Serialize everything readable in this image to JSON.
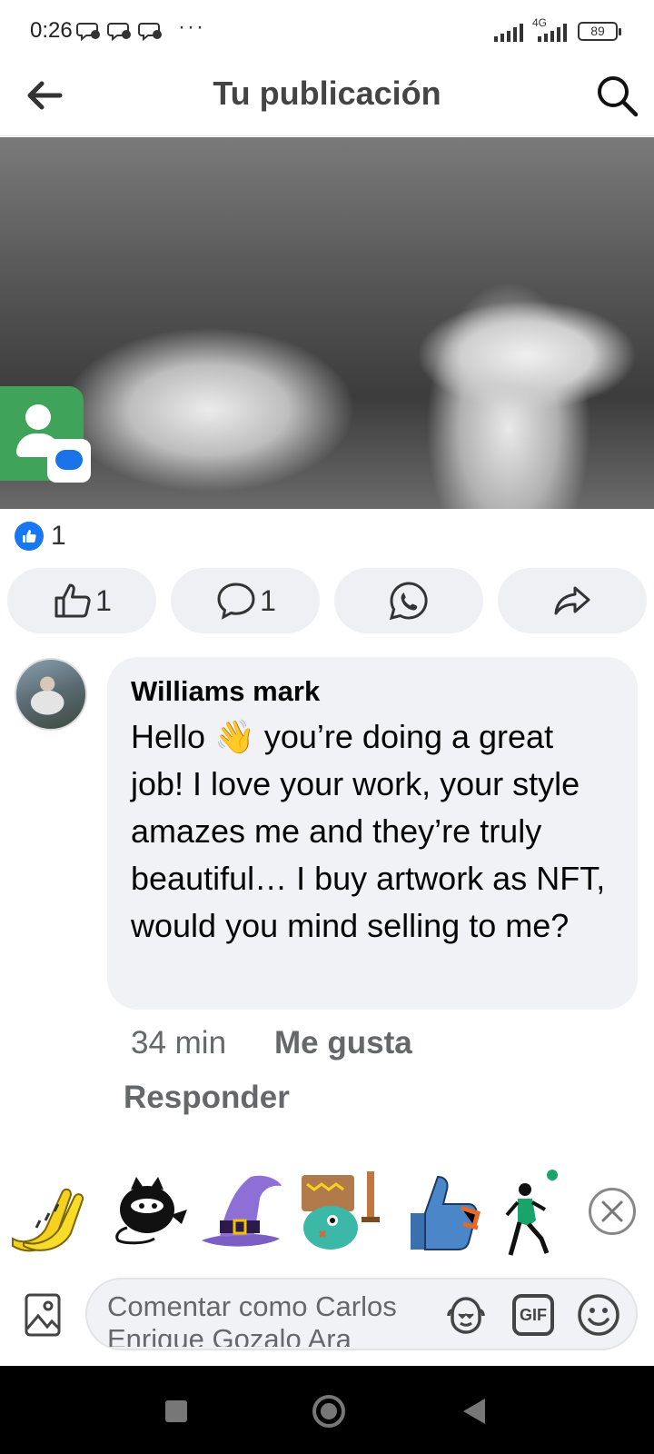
{
  "status_bar": {
    "time": "0:26",
    "notification_icons": [
      "messenger-icon",
      "messenger-icon",
      "messenger-icon"
    ],
    "more": "···",
    "network": "4G",
    "battery": "89"
  },
  "header": {
    "title": "Tu publicación",
    "back_icon": "back-arrow-icon",
    "search_icon": "search-icon"
  },
  "post": {
    "reaction_count": "1"
  },
  "actions": {
    "like_count": "1",
    "comment_count": "1"
  },
  "comment": {
    "author": "Williams mark",
    "text": "Hello 👋 you’re doing a great job! I love your work, your style amazes me and they’re truly beautiful… I buy artwork as NFT, would you mind selling to me?",
    "time": "34 min",
    "like_label": "Me gusta",
    "reply_label": "Responder"
  },
  "stickers": [
    "bananas-sticker",
    "black-cat-sticker",
    "witch-hat-sticker",
    "robot-monster-sticker",
    "thumbs-up-sticker",
    "soccer-player-sticker"
  ],
  "composer": {
    "placeholder": "Comentar como Carlos Enrique Gozalo Ara",
    "gif_label": "GIF"
  },
  "colors": {
    "accent": "#1877f2",
    "bubble": "#f0f2f5",
    "secondary_text": "#65676b"
  }
}
